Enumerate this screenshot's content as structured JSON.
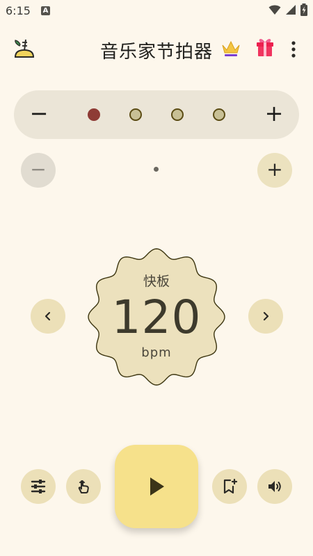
{
  "status_bar": {
    "time": "6:15",
    "notification_letter": "A"
  },
  "app_bar": {
    "title": "音乐家节拍器"
  },
  "beats": {
    "minus_label": "−",
    "plus_label": "+",
    "count": 4,
    "accent_index": 0
  },
  "subdivision": {
    "minus_label": "−",
    "plus_label": "+"
  },
  "tempo": {
    "name": "快板",
    "bpm": "120",
    "unit": "bpm"
  },
  "colors": {
    "background": "#fdf7ec",
    "primary_button": "#f6e18b",
    "secondary_button": "#ece0b8",
    "accent_beat": "#8e3b35",
    "normal_beat": "#c8c095"
  },
  "icons": {
    "app_logo": "metronome-logo-icon",
    "premium": "crown-icon",
    "gift": "gift-icon",
    "menu": "more-vert-icon",
    "play": "play-icon",
    "settings": "sliders-icon",
    "tap_tempo": "tap-hand-icon",
    "bookmark": "bookmark-add-icon",
    "volume": "volume-icon"
  }
}
